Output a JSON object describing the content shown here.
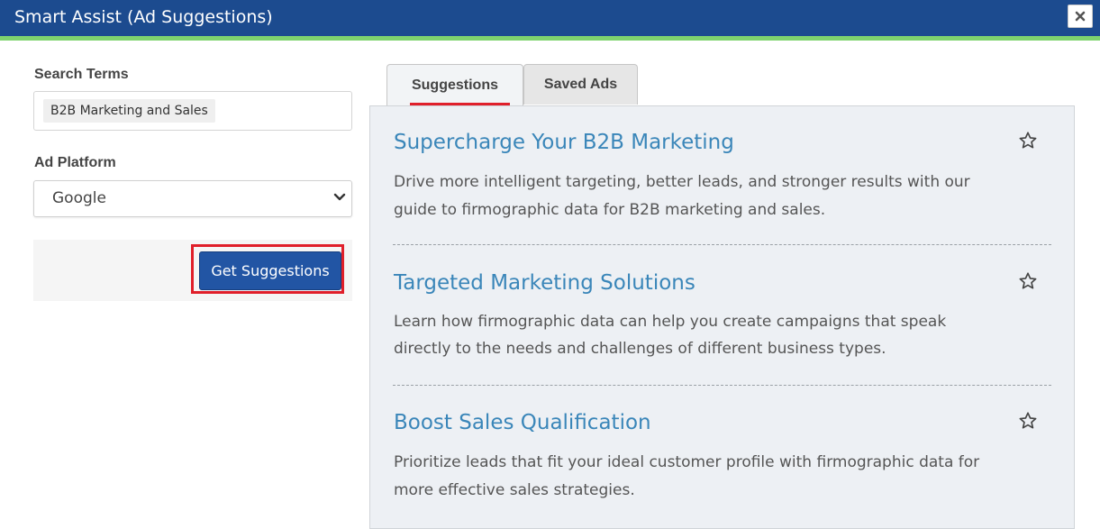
{
  "window": {
    "title": "Smart Assist (Ad Suggestions)",
    "close_label": "×"
  },
  "form": {
    "search_label": "Search Terms",
    "search_chip": "B2B Marketing and Sales",
    "platform_label": "Ad Platform",
    "platform_value": "Google",
    "submit_label": "Get Suggestions"
  },
  "tabs": [
    {
      "label": "Suggestions",
      "active": true
    },
    {
      "label": "Saved Ads",
      "active": false
    }
  ],
  "suggestions": [
    {
      "title": "Supercharge Your B2B Marketing",
      "line1": "Drive more intelligent targeting, better leads, and stronger results with our",
      "line2": "guide to firmographic data for B2B marketing and sales."
    },
    {
      "title": "Targeted Marketing Solutions",
      "line1": "Learn how firmographic data can help you create campaigns that speak",
      "line2": "directly to the needs and challenges of different business types."
    },
    {
      "title": "Boost Sales Qualification",
      "line1": "Prioritize leads that fit your ideal customer profile with firmographic data for",
      "line2": "more effective sales strategies."
    }
  ],
  "colors": {
    "header": "#1c4b8f",
    "accent": "#7ed36e",
    "link": "#3a86b9",
    "primary_button": "#2255a4",
    "highlight": "#e01f2a"
  }
}
